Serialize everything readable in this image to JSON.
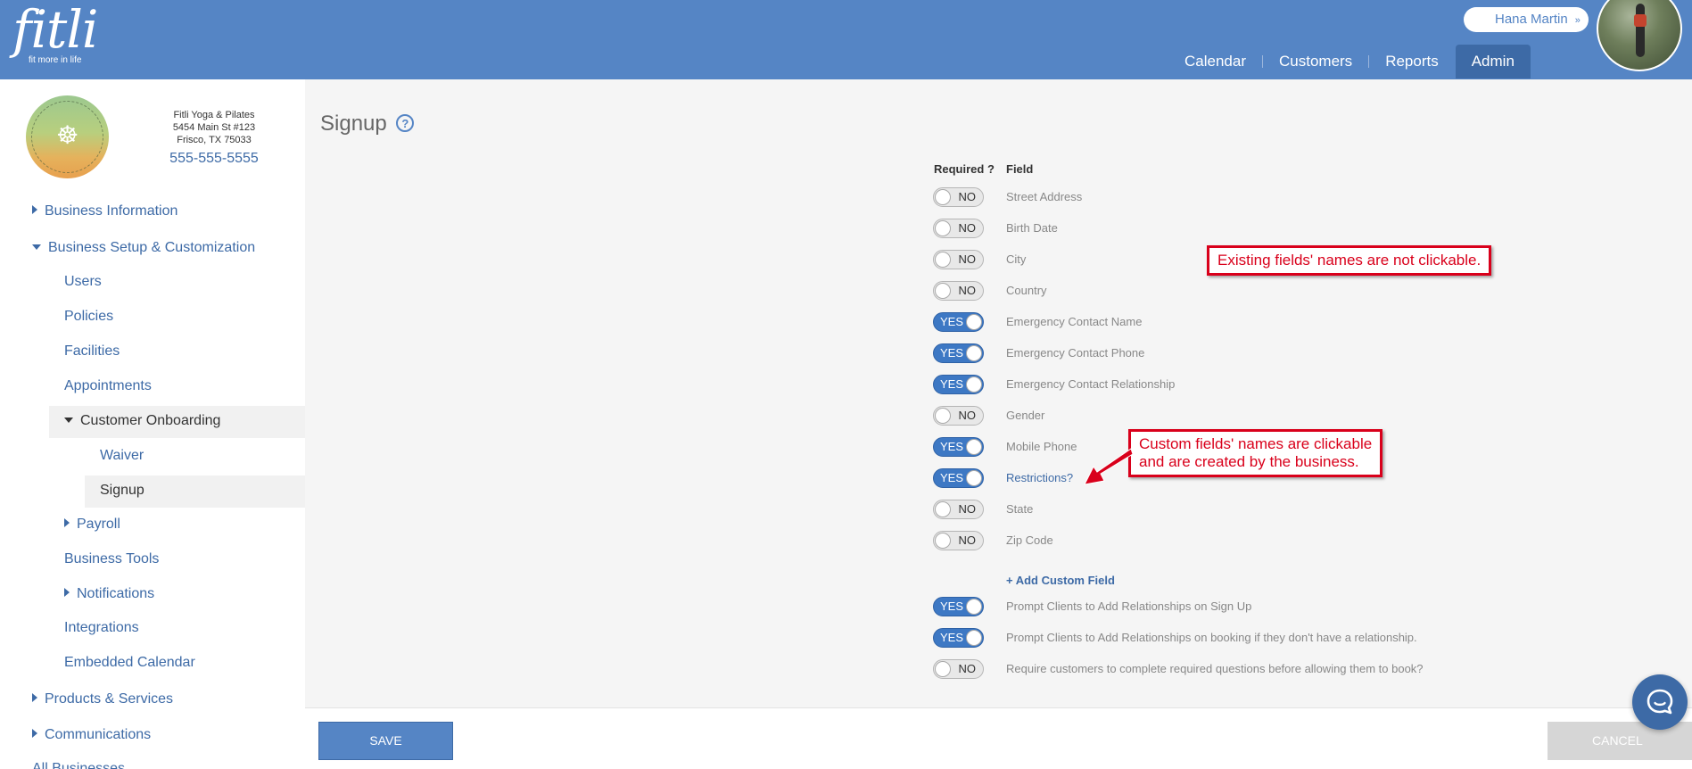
{
  "header": {
    "logo_word": "fitli",
    "logo_tagline": "fit more in life",
    "user_name": "Hana Martin",
    "user_chevron": "»",
    "nav": [
      "Calendar",
      "Customers",
      "Reports",
      "Admin"
    ],
    "active_nav": "Admin"
  },
  "business": {
    "name": "Fitli Yoga & Pilates",
    "street": "5454 Main St #123",
    "city_line": "Frisco, TX 75033",
    "phone": "555-555-5555"
  },
  "sidebar": {
    "items": [
      {
        "label": "Business Information",
        "level": 0,
        "expanded": false
      },
      {
        "label": "Business Setup & Customization",
        "level": 0,
        "expanded": true
      },
      {
        "label": "Users",
        "level": 1
      },
      {
        "label": "Policies",
        "level": 1
      },
      {
        "label": "Facilities",
        "level": 1
      },
      {
        "label": "Appointments",
        "level": 1
      },
      {
        "label": "Customer Onboarding",
        "level": 1,
        "expanded": true
      },
      {
        "label": "Waiver",
        "level": 2
      },
      {
        "label": "Signup",
        "level": 2,
        "selected": true
      },
      {
        "label": "Payroll",
        "level": 1,
        "expanded": false
      },
      {
        "label": "Business Tools",
        "level": 1
      },
      {
        "label": "Notifications",
        "level": 1,
        "expanded": false
      },
      {
        "label": "Integrations",
        "level": 1
      },
      {
        "label": "Embedded Calendar",
        "level": 1
      },
      {
        "label": "Products & Services",
        "level": 0,
        "expanded": false
      },
      {
        "label": "Communications",
        "level": 0,
        "expanded": false
      },
      {
        "label": "All Businesses",
        "level": 0
      }
    ]
  },
  "main": {
    "title": "Signup",
    "help_glyph": "?",
    "col_required": "Required ?",
    "col_field": "Field",
    "fields": [
      {
        "label": "Street Address",
        "required": "NO",
        "custom": false
      },
      {
        "label": "Birth Date",
        "required": "NO",
        "custom": false
      },
      {
        "label": "City",
        "required": "NO",
        "custom": false
      },
      {
        "label": "Country",
        "required": "NO",
        "custom": false
      },
      {
        "label": "Emergency Contact Name",
        "required": "YES",
        "custom": false
      },
      {
        "label": "Emergency Contact Phone",
        "required": "YES",
        "custom": false
      },
      {
        "label": "Emergency Contact Relationship",
        "required": "YES",
        "custom": false
      },
      {
        "label": "Gender",
        "required": "NO",
        "custom": false
      },
      {
        "label": "Mobile Phone",
        "required": "YES",
        "custom": false
      },
      {
        "label": "Restrictions?",
        "required": "YES",
        "custom": true
      },
      {
        "label": "State",
        "required": "NO",
        "custom": false
      },
      {
        "label": "Zip Code",
        "required": "NO",
        "custom": false
      }
    ],
    "add_custom_field": "+ Add Custom Field",
    "options": [
      {
        "label": "Prompt Clients to Add Relationships on Sign Up",
        "value": "YES"
      },
      {
        "label": "Prompt Clients to Add Relationships on booking if they don't have a relationship.",
        "value": "YES"
      },
      {
        "label": "Require customers to complete required questions before allowing them to book?",
        "value": "NO"
      }
    ]
  },
  "annotations": {
    "existing": "Existing fields' names are not clickable.",
    "custom_line1": "Custom fields' names are clickable",
    "custom_line2": "and are created by the business."
  },
  "footer": {
    "save": "SAVE",
    "cancel": "CANCEL"
  },
  "colors": {
    "header": "#5585c5",
    "link": "#3d6aa6",
    "toggle_on": "#3d78c4",
    "annotation": "#d9001b"
  }
}
